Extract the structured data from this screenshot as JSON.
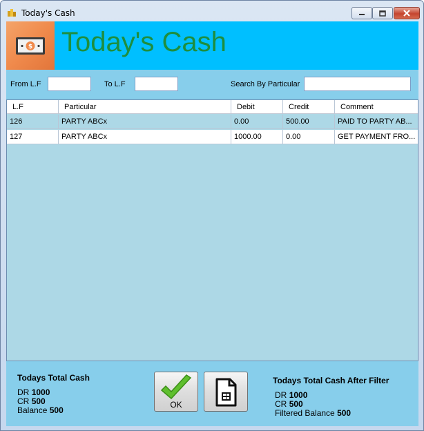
{
  "window": {
    "title": "Today's Cash"
  },
  "header": {
    "heading": "Today's Cash",
    "logo_icon": "cash-icon"
  },
  "filters": {
    "from_label": "From L.F",
    "from_value": "",
    "to_label": "To L.F",
    "to_value": "",
    "search_label": "Search By Particular",
    "search_value": ""
  },
  "grid": {
    "columns": [
      "L.F",
      "Particular",
      "Debit",
      "Credit",
      "Comment"
    ],
    "rows": [
      [
        "126",
        "PARTY ABCx",
        "0.00",
        "500.00",
        "PAID TO PARTY AB..."
      ],
      [
        "127",
        "PARTY ABCx",
        "1000.00",
        "0.00",
        "GET PAYMENT FRO..."
      ]
    ]
  },
  "totals": {
    "title": "Todays Total Cash",
    "dr_label": "DR",
    "dr_value": "1000",
    "cr_label": "CR",
    "cr_value": "500",
    "balance_label": "Balance",
    "balance_value": "500"
  },
  "filtered_totals": {
    "title": "Todays Total Cash After Filter",
    "dr_label": "DR",
    "dr_value": "1000",
    "cr_label": "CR",
    "cr_value": "500",
    "balance_label": "Filtered Balance",
    "balance_value": "500"
  },
  "buttons": {
    "ok_label": "OK",
    "ok_icon": "checkmark-icon",
    "report_icon": "document-icon"
  },
  "colors": {
    "header_bg": "#00bfff",
    "client_bg": "#87ceeb",
    "grid_bg": "#add8e6",
    "heading": "#1e8e3e"
  }
}
